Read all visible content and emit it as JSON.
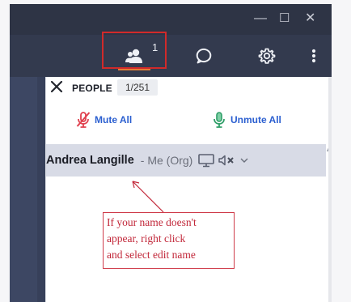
{
  "window": {
    "minimize_glyph": "—",
    "maximize_glyph": "☐",
    "close_glyph": "✕"
  },
  "toolbar": {
    "people_count": "1",
    "icons": [
      "people-icon",
      "chat-icon",
      "gear-icon",
      "more-icon"
    ],
    "highlight_color": "#d12a2a",
    "active_underline_color": "#e37c36"
  },
  "panel": {
    "title": "PEOPLE",
    "count_badge": "1/251",
    "mute_all_label": "Mute All",
    "unmute_all_label": "Unmute All"
  },
  "participant": {
    "name": "Andrea Langille",
    "role": "- Me (Org)",
    "icons": [
      "screen-share-icon",
      "speaker-muted-icon",
      "chevron-down-icon"
    ]
  },
  "annotation": {
    "lines": [
      "If your name doesn't",
      "appear, right click",
      "and select edit name"
    ],
    "color": "#c2283a"
  }
}
